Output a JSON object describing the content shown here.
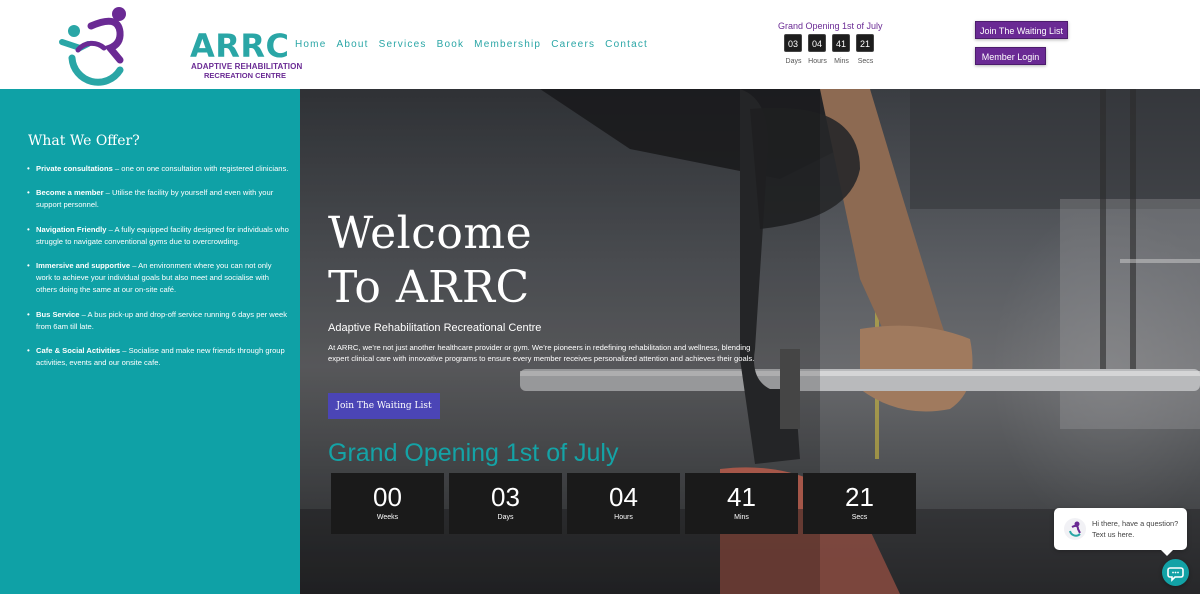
{
  "header": {
    "logo": {
      "name": "ARRC",
      "subtitle_line1": "ADAPTIVE REHABILITATION",
      "subtitle_line2": "RECREATION CENTRE",
      "icon": "wheelchair-figure-icon"
    },
    "nav": [
      "Home",
      "About",
      "Services",
      "Book",
      "Membership",
      "Careers",
      "Contact"
    ],
    "mini_countdown": {
      "title": "Grand Opening 1st of July",
      "units": [
        {
          "value": "03",
          "label": "Days"
        },
        {
          "value": "04",
          "label": "Hours"
        },
        {
          "value": "41",
          "label": "Mins"
        },
        {
          "value": "21",
          "label": "Secs"
        }
      ]
    },
    "buttons": {
      "waiting_list": "Join The Waiting List",
      "member_login": "Member Login"
    }
  },
  "sidebar": {
    "title": "What We Offer?",
    "items": [
      {
        "bold": "Private consultations",
        "text": " – one on one consultation with registered clinicians."
      },
      {
        "bold": "Become a member",
        "text": " – Utilise the facility by yourself and even with your support personnel."
      },
      {
        "bold": "Navigation Friendly",
        "text": " – A fully equipped facility designed for individuals who struggle to navigate conventional gyms due to overcrowding."
      },
      {
        "bold": "Immersive and supportive",
        "text": " – An environment where you can not only work to achieve your individual goals but also meet and socialise with others doing the same at our on-site café."
      },
      {
        "bold": "Bus Service",
        "text": " – A bus pick-up and drop-off service running 6 days per week from 6am till late."
      },
      {
        "bold": "Cafe & Social Activities",
        "text": " – Socialise and make new friends through group activities, events and our onsite cafe."
      }
    ]
  },
  "hero": {
    "heading": "Welcome\nTo ARRC",
    "subheading": "Adaptive Rehabilitation Recreational Centre",
    "paragraph": "At ARRC, we’re not just another healthcare provider or gym. We’re pioneers in redefining rehabilitation and wellness, blending expert clinical care with innovative programs to ensure every member receives personalized attention and achieves their goals.",
    "button": "Join The Waiting List",
    "countdown_title": "Grand Opening 1st of July",
    "countdown": [
      {
        "value": "00",
        "label": "Weeks"
      },
      {
        "value": "03",
        "label": "Days"
      },
      {
        "value": "04",
        "label": "Hours"
      },
      {
        "value": "41",
        "label": "Mins"
      },
      {
        "value": "21",
        "label": "Secs"
      }
    ]
  },
  "chat": {
    "message": "Hi there, have a question? Text us here.",
    "avatar_icon": "chat-avatar-icon",
    "button_icon": "chat-icon"
  },
  "colors": {
    "teal": "#0fa1a6",
    "purple": "#6a2a94",
    "button_blue": "#4b45b6",
    "dark_box": "#1a1a1a"
  }
}
